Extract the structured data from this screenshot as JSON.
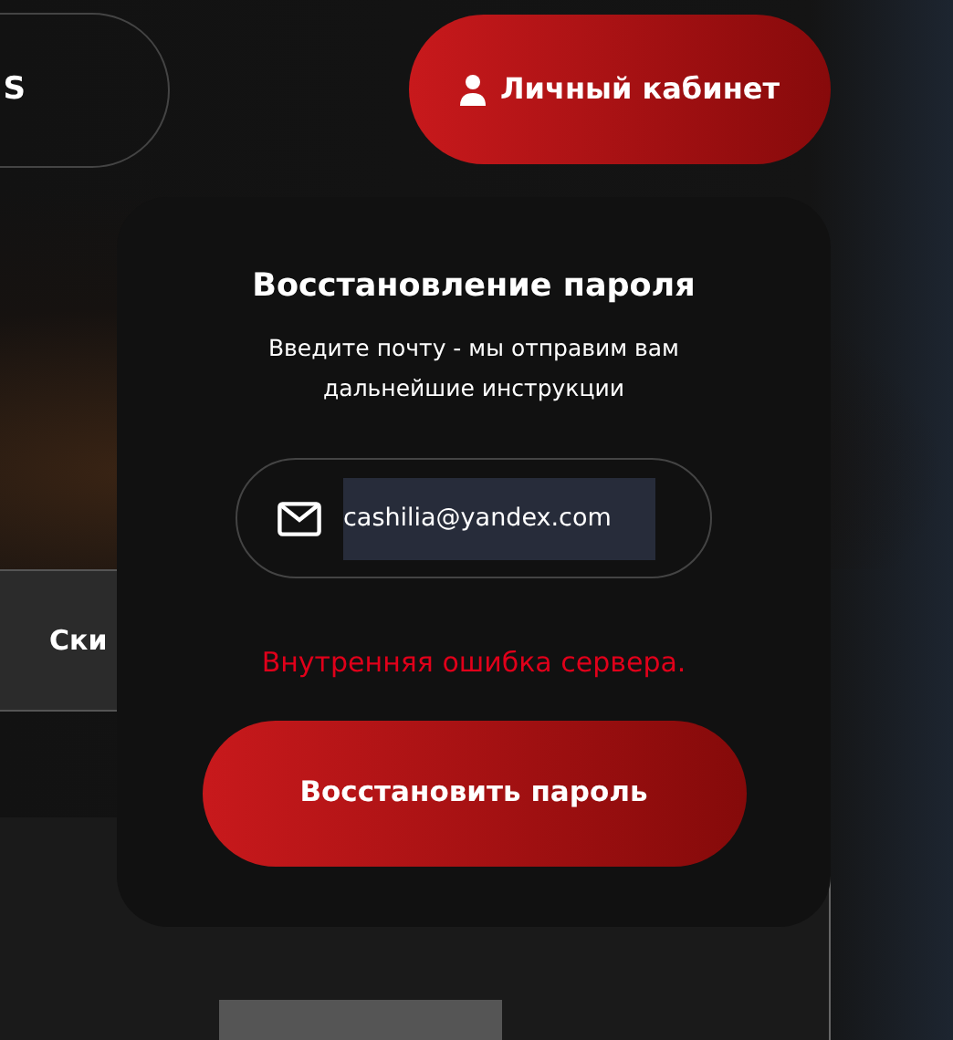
{
  "header": {
    "left_button": "S",
    "account_button": "Личный кабинет"
  },
  "side_tab": "Ски",
  "dialog": {
    "title": "Восстановление пароля",
    "subtitle": "Введите почту - мы отправим вам дальнейшие инструкции",
    "email_field": {
      "value": "cashilia@yandex.com",
      "text_selected": true
    },
    "error": "Внутренняя ошибка сервера.",
    "submit_button": "Восстановить пароль"
  }
}
